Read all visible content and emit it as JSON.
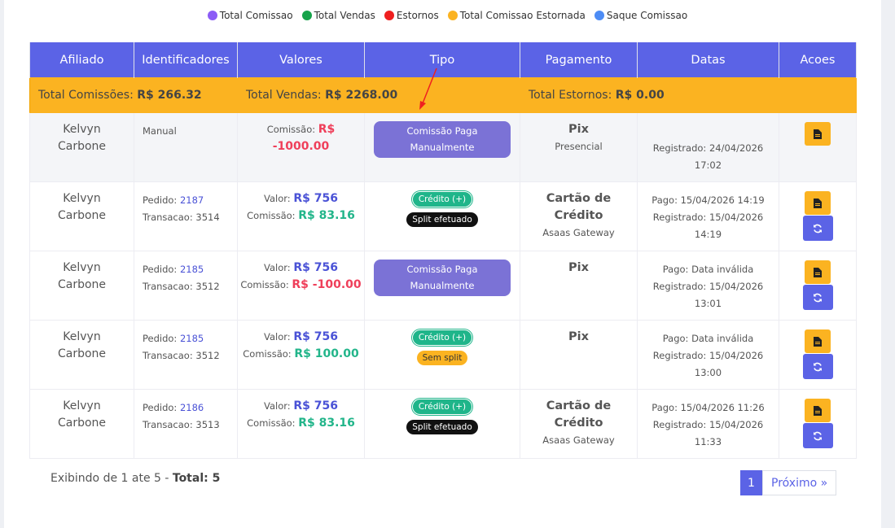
{
  "legend": [
    {
      "label": "Total Comissao",
      "color": "#8b5cf6"
    },
    {
      "label": "Total Vendas",
      "color": "#16a34a"
    },
    {
      "label": "Estornos",
      "color": "#ef1f1f"
    },
    {
      "label": "Total Comissao Estornada",
      "color": "#fbb321"
    },
    {
      "label": "Saque Comissao",
      "color": "#4d8cf5"
    }
  ],
  "headers": {
    "afiliado": "Afiliado",
    "identificadores": "Identificadores",
    "valores": "Valores",
    "tipo": "Tipo",
    "pagamento": "Pagamento",
    "datas": "Datas",
    "acoes": "Acoes"
  },
  "totals": {
    "comissoes_label": "Total Comissões:",
    "comissoes_value": "R$ 266.32",
    "vendas_label": "Total Vendas:",
    "vendas_value": "R$ 2268.00",
    "estornos_label": "Total Estornos:",
    "estornos_value": "R$ 0.00"
  },
  "rows": [
    {
      "afiliado_line1": "Kelvyn",
      "afiliado_line2": "Carbone",
      "ident": "Manual",
      "comissao_label": "Comissão:",
      "comissao_prefix": "R$",
      "comissao_value": "-1000.00",
      "tipo_line1": "Comissão Paga",
      "tipo_line2": "Manualmente",
      "pagamento": "Pix",
      "pagamento_sub": "Presencial",
      "registrado": "Registrado: 24/04/2026",
      "registrado_time": "17:02"
    },
    {
      "afiliado_line1": "Kelvyn",
      "afiliado_line2": "Carbone",
      "pedido_label": "Pedido:",
      "pedido": "2187",
      "transacao": "Transacao: 3514",
      "valor_label": "Valor:",
      "valor": "R$ 756",
      "comissao_label": "Comissão:",
      "comissao_value": "R$ 83.16",
      "badge1": "Crédito (+)",
      "badge2": "Split efetuado",
      "pagamento_line1": "Cartão de",
      "pagamento_line2": "Crédito",
      "pagamento_sub": "Asaas Gateway",
      "pago": "Pago: 15/04/2026 14:19",
      "registrado": "Registrado: 15/04/2026",
      "registrado_time": "14:19"
    },
    {
      "afiliado_line1": "Kelvyn",
      "afiliado_line2": "Carbone",
      "pedido_label": "Pedido:",
      "pedido": "2185",
      "transacao": "Transacao: 3512",
      "valor_label": "Valor:",
      "valor": "R$ 756",
      "comissao_label": "Comissão:",
      "comissao_value": "R$ -100.00",
      "tipo_line1": "Comissão Paga",
      "tipo_line2": "Manualmente",
      "pagamento": "Pix",
      "pago": "Pago: Data inválida",
      "registrado": "Registrado: 15/04/2026",
      "registrado_time": "13:01"
    },
    {
      "afiliado_line1": "Kelvyn",
      "afiliado_line2": "Carbone",
      "pedido_label": "Pedido:",
      "pedido": "2185",
      "transacao": "Transacao: 3512",
      "valor_label": "Valor:",
      "valor": "R$ 756",
      "comissao_label": "Comissão:",
      "comissao_value": "R$ 100.00",
      "badge1": "Crédito (+)",
      "badge2": "Sem split",
      "pagamento": "Pix",
      "pago": "Pago: Data inválida",
      "registrado": "Registrado: 15/04/2026",
      "registrado_time": "13:00"
    },
    {
      "afiliado_line1": "Kelvyn",
      "afiliado_line2": "Carbone",
      "pedido_label": "Pedido:",
      "pedido": "2186",
      "transacao": "Transacao: 3513",
      "valor_label": "Valor:",
      "valor": "R$ 756",
      "comissao_label": "Comissão:",
      "comissao_value": "R$ 83.16",
      "badge1": "Crédito (+)",
      "badge2": "Split efetuado",
      "pagamento_line1": "Cartão de",
      "pagamento_line2": "Crédito",
      "pagamento_sub": "Asaas Gateway",
      "pago": "Pago: 15/04/2026 11:26",
      "registrado": "Registrado: 15/04/2026",
      "registrado_time": "11:33"
    }
  ],
  "footer": {
    "showing": "Exibindo de 1 ate 5 -",
    "total": "Total: 5"
  },
  "pagination": {
    "current": "1",
    "next": "Próximo »"
  },
  "icons": {
    "document": "document-icon",
    "refresh": "refresh-icon"
  }
}
